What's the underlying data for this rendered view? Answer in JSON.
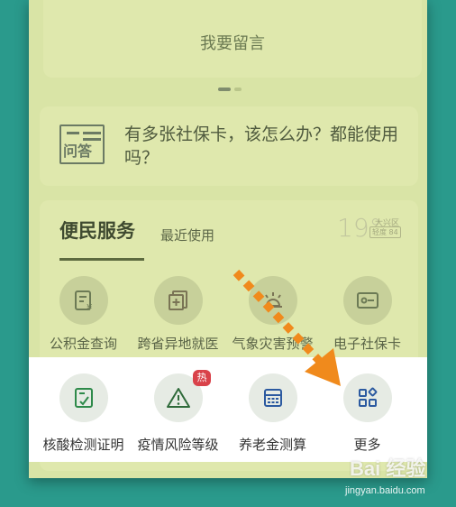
{
  "message_card": {
    "label": "我要留言"
  },
  "qa_card": {
    "icon_text": "问答",
    "question": "有多张社保卡，该怎么办？都能使用吗？"
  },
  "services": {
    "tab_active": "便民服务",
    "tab_recent": "最近使用",
    "weather": {
      "temp": "19°",
      "location": "大兴区",
      "aqi": "轻度 84"
    },
    "row1": [
      {
        "label": "公积金查询",
        "icon": "fund-document-icon"
      },
      {
        "label": "跨省异地就医",
        "icon": "medical-plus-icon"
      },
      {
        "label": "气象灾害预警",
        "icon": "weather-alert-icon"
      },
      {
        "label": "电子社保卡",
        "icon": "social-security-card-icon"
      }
    ],
    "row2": [
      {
        "label": "核酸检测证明",
        "icon": "nucleic-test-icon"
      },
      {
        "label": "疫情风险等级",
        "icon": "warning-triangle-icon",
        "badge": "热"
      },
      {
        "label": "养老金测算",
        "icon": "calculator-icon"
      },
      {
        "label": "更多",
        "icon": "more-grid-icon"
      }
    ]
  },
  "watermark": {
    "brand": "Bai 经验",
    "url": "jingyan.baidu.com"
  },
  "colors": {
    "background": "#2a9a8c",
    "arrow": "#f08a1c",
    "hot_badge": "#d9424a"
  }
}
